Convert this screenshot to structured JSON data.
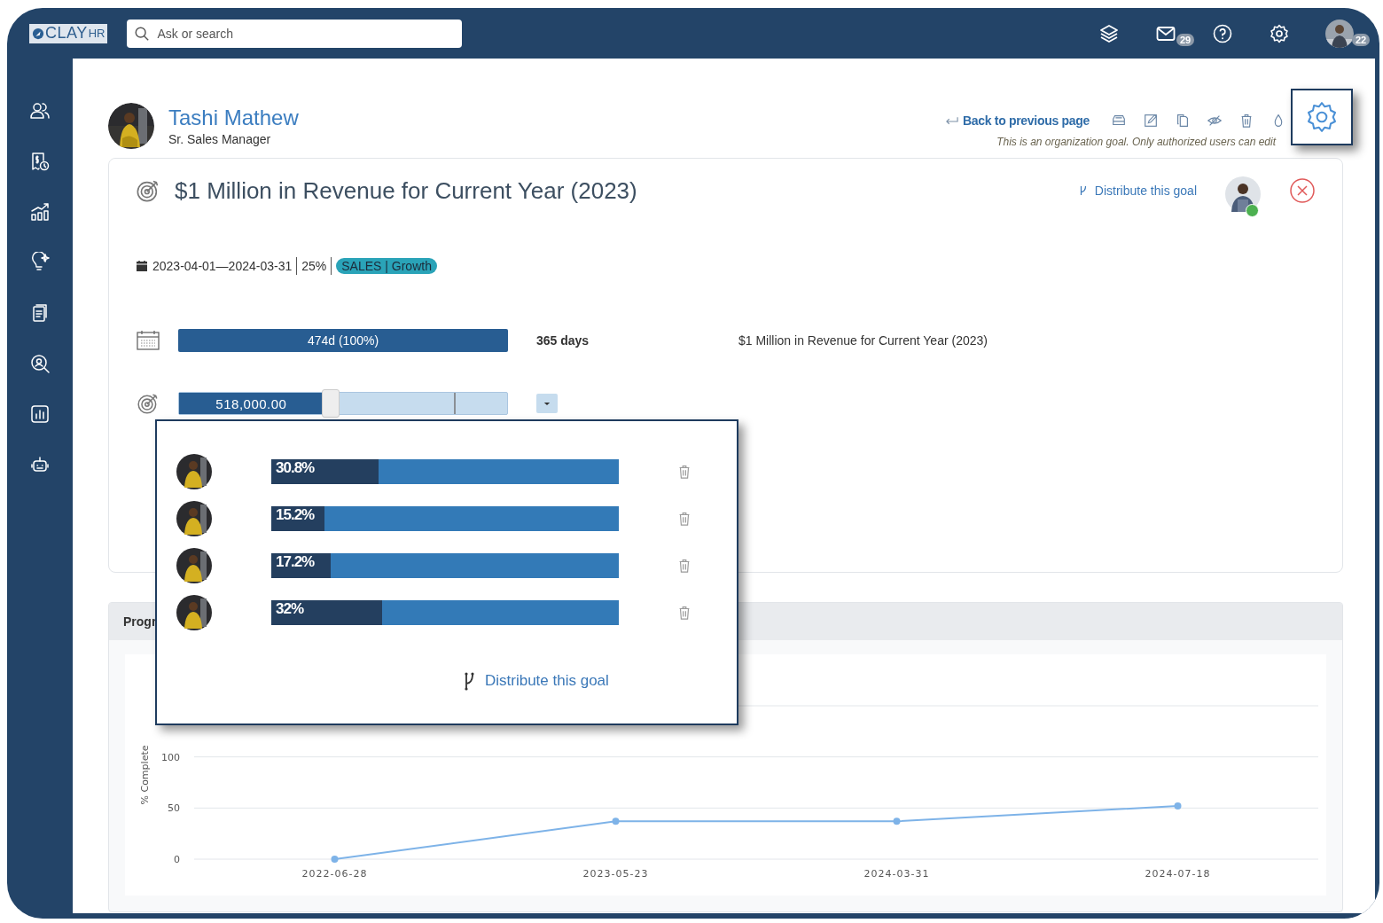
{
  "topbar": {
    "logo": {
      "brand": "CLAY",
      "suffix": "HR"
    },
    "search": {
      "placeholder": "Ask or search"
    },
    "mail_badge": "29",
    "profile_badge": "22"
  },
  "profile": {
    "name": "Tashi Mathew",
    "role": "Sr. Sales Manager"
  },
  "header_actions": {
    "back_link": "Back to previous page",
    "note": "This is an organization goal. Only authorized users can edit"
  },
  "goal": {
    "title": "$1 Million in Revenue for Current Year (2023)",
    "distribute_link": "Distribute this goal",
    "date_range": "2023-04-01—2024-03-31",
    "weight": "25%",
    "tag": "SALES | Growth",
    "time": {
      "label": "474d (100%)",
      "level": 1,
      "duration": "365 days",
      "goal_name": "$1 Million in Revenue for Current Year (2023)"
    },
    "target": {
      "value": "518,000.00",
      "level": 0.44
    }
  },
  "distribution_popup": {
    "rows": [
      {
        "label": "30.8%",
        "level": 0.308
      },
      {
        "label": "15.2%",
        "level": 0.152
      },
      {
        "label": "17.2%",
        "level": 0.172
      },
      {
        "label": "32%",
        "level": 0.32
      }
    ],
    "distribute_link": "Distribute this goal"
  },
  "progress": {
    "title": "Progr",
    "chart_data": {
      "type": "line",
      "ylabel": "% Complete",
      "categories": [
        "2022-06-28",
        "2023-05-23",
        "2024-03-31",
        "2024-07-18"
      ],
      "series": [
        {
          "color": "#7eb3e8",
          "marker": true,
          "values": [
            0,
            37,
            37,
            52
          ]
        }
      ],
      "ylim": [
        0,
        150
      ],
      "yticks": [
        0,
        50,
        100
      ]
    }
  }
}
